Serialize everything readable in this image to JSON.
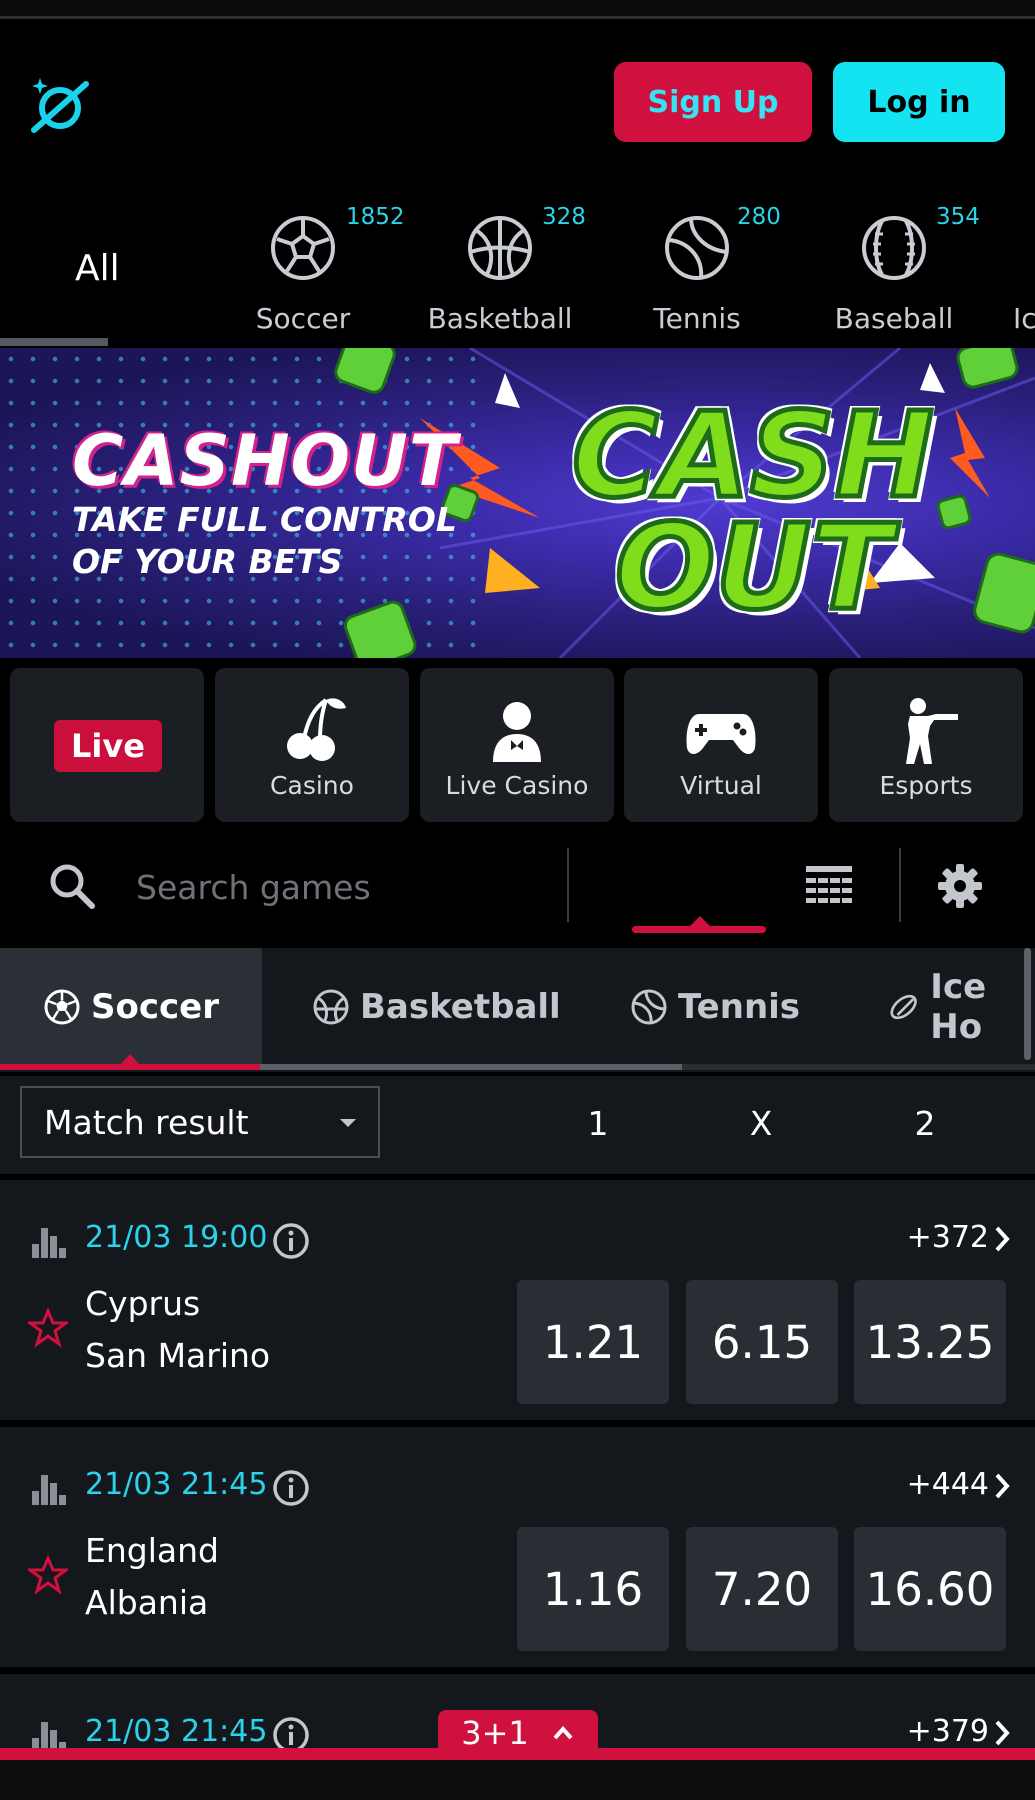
{
  "header": {
    "signup_label": "Sign Up",
    "login_label": "Log in"
  },
  "sports_strip": {
    "all_label": "All",
    "items": [
      {
        "label": "Soccer",
        "count": "1852",
        "icon": "soccer-ball-icon"
      },
      {
        "label": "Basketball",
        "count": "328",
        "icon": "basketball-icon"
      },
      {
        "label": "Tennis",
        "count": "280",
        "icon": "tennis-ball-icon"
      },
      {
        "label": "Baseball",
        "count": "354",
        "icon": "baseball-icon"
      },
      {
        "label": "Ic",
        "count": "",
        "icon": ""
      }
    ]
  },
  "banner": {
    "title": "CASHOUT",
    "subtitle_line1": "TAKE FULL CONTROL",
    "subtitle_line2": "OF YOUR BETS",
    "art_line1": "CASH",
    "art_line2": "OUT"
  },
  "categories": [
    {
      "label": "Live",
      "icon": ""
    },
    {
      "label": "Casino",
      "icon": "cherries-icon"
    },
    {
      "label": "Live Casino",
      "icon": "dealer-icon"
    },
    {
      "label": "Virtual",
      "icon": "gamepad-icon"
    },
    {
      "label": "Esports",
      "icon": "soldier-icon"
    }
  ],
  "search": {
    "placeholder": "Search games"
  },
  "sport_tabs": [
    {
      "label": "Soccer",
      "active": true
    },
    {
      "label": "Basketball",
      "active": false
    },
    {
      "label": "Tennis",
      "active": false
    },
    {
      "label": "Ice Ho",
      "active": false
    }
  ],
  "market": {
    "selected": "Match result",
    "col1": "1",
    "colx": "X",
    "col2": "2"
  },
  "matches": [
    {
      "time": "21/03 19:00",
      "more": "+372",
      "team1": "Cyprus",
      "team2": "San Marino",
      "odds": [
        "1.21",
        "6.15",
        "13.25"
      ]
    },
    {
      "time": "21/03 21:45",
      "more": "+444",
      "team1": "England",
      "team2": "Albania",
      "odds": [
        "1.16",
        "7.20",
        "16.60"
      ]
    },
    {
      "time": "21/03 21:45",
      "more": "+379",
      "team1": "",
      "team2": "",
      "odds": []
    }
  ],
  "betslip": {
    "label": "3+1"
  },
  "colors": {
    "accent_red": "#d0103e",
    "accent_cyan": "#14e3f2",
    "time_cyan": "#2bd3ea",
    "background": "#000000",
    "panel": "#14171b",
    "odd_box": "#2a2e34"
  }
}
